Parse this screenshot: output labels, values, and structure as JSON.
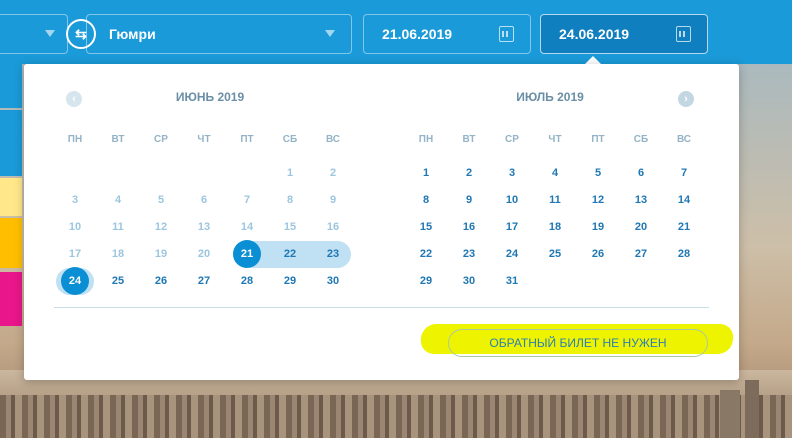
{
  "search": {
    "origin_value": "",
    "destination_value": "Гюмри",
    "depart_date": "21.06.2019",
    "return_date": "24.06.2019"
  },
  "calendar": {
    "weekdays": [
      "ПН",
      "ВТ",
      "СР",
      "ЧТ",
      "ПТ",
      "СБ",
      "ВС"
    ],
    "months": [
      {
        "title": "ИЮНЬ 2019",
        "weeks": [
          [
            "",
            "",
            "",
            "",
            "",
            "1",
            "2"
          ],
          [
            "3",
            "4",
            "5",
            "6",
            "7",
            "8",
            "9"
          ],
          [
            "10",
            "11",
            "12",
            "13",
            "14",
            "15",
            "16"
          ],
          [
            "17",
            "18",
            "19",
            "20",
            "21",
            "22",
            "23"
          ],
          [
            "24",
            "25",
            "26",
            "27",
            "28",
            "29",
            "30"
          ]
        ]
      },
      {
        "title": "ИЮЛЬ 2019",
        "weeks": [
          [
            "1",
            "2",
            "3",
            "4",
            "5",
            "6",
            "7"
          ],
          [
            "8",
            "9",
            "10",
            "11",
            "12",
            "13",
            "14"
          ],
          [
            "15",
            "16",
            "17",
            "18",
            "19",
            "20",
            "21"
          ],
          [
            "22",
            "23",
            "24",
            "25",
            "26",
            "27",
            "28"
          ],
          [
            "29",
            "30",
            "31",
            "",
            "",
            "",
            ""
          ]
        ]
      }
    ],
    "selected_start": "21",
    "selected_end": "24",
    "no_return_label": "ОБРАТНЫЙ БИЛЕТ НЕ НУЖЕН"
  },
  "icons": {
    "swap": "swap-arrows-icon",
    "calendar": "calendar-icon",
    "prev": "chevron-left-icon",
    "next": "chevron-right-icon"
  },
  "colors": {
    "header": "#1a9ad8",
    "selected": "#0a8fd4",
    "range": "#bfe1f3",
    "highlight": "#eef400"
  }
}
